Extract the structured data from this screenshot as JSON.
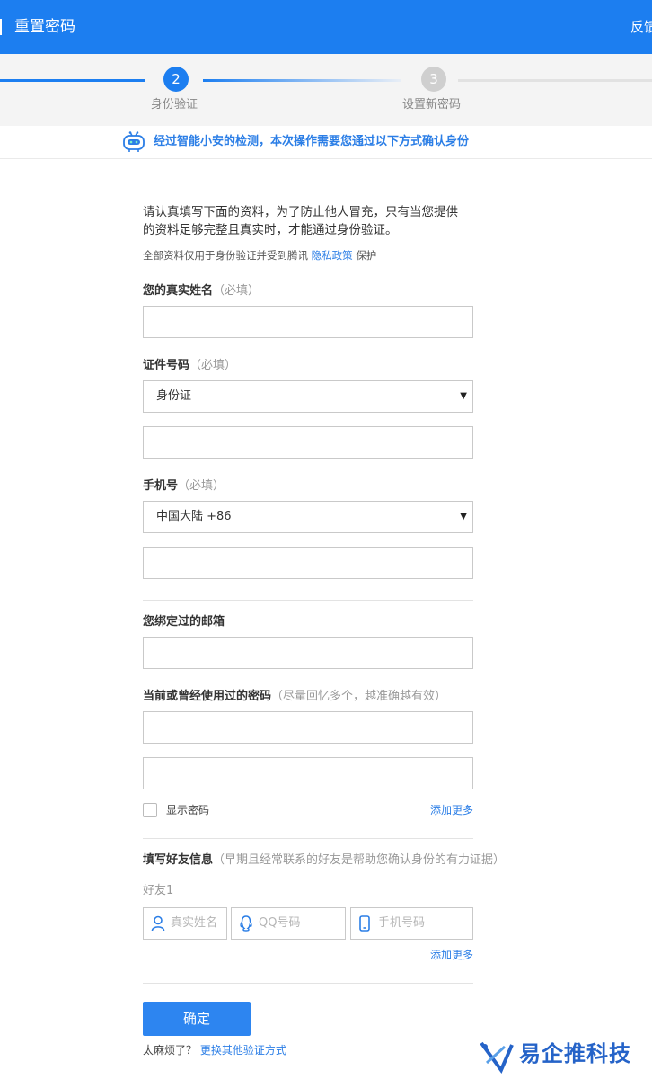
{
  "header": {
    "title": "重置密码",
    "feedback": "反馈"
  },
  "steps": [
    {
      "number": "2",
      "label": "身份验证",
      "active": true
    },
    {
      "number": "3",
      "label": "设置新密码",
      "active": false
    }
  ],
  "notice": {
    "text": "经过智能小安的检测，本次操作需要您通过以下方式确认身份"
  },
  "intro": {
    "line1": "请认真填写下面的资料，为了防止他人冒充，只有当您提供",
    "line2": "的资料足够完整且真实时，才能通过身份验证。",
    "privacy_prefix": "全部资料仅用于身份验证并受到腾讯",
    "privacy_link": "隐私政策",
    "privacy_suffix": "保护"
  },
  "fields": {
    "name_label": "您的真实姓名",
    "name_hint": "（必填）",
    "id_label": "证件号码",
    "id_hint": "（必填）",
    "id_type": "身份证",
    "phone_label": "手机号",
    "phone_hint": "（必填）",
    "phone_region": "中国大陆 +86",
    "email_label": "您绑定过的邮箱",
    "password_label": "当前或曾经使用过的密码",
    "password_hint": "（尽量回忆多个，越准确越有效）",
    "show_password": "显示密码",
    "add_more": "添加更多"
  },
  "friends": {
    "label": "填写好友信息",
    "hint": "（早期且经常联系的好友是帮助您确认身份的有力证据）",
    "friend_title": "好友1",
    "name_placeholder": "真实姓名",
    "qq_placeholder": "QQ号码",
    "phone_placeholder": "手机号码",
    "add_more": "添加更多"
  },
  "actions": {
    "submit": "确定",
    "other_prefix": "太麻烦了？",
    "other_link": "更换其他验证方式"
  },
  "watermark": {
    "text": "易企推科技"
  },
  "colors": {
    "brand": "#1c7ef0",
    "link": "#2b7ee6"
  }
}
